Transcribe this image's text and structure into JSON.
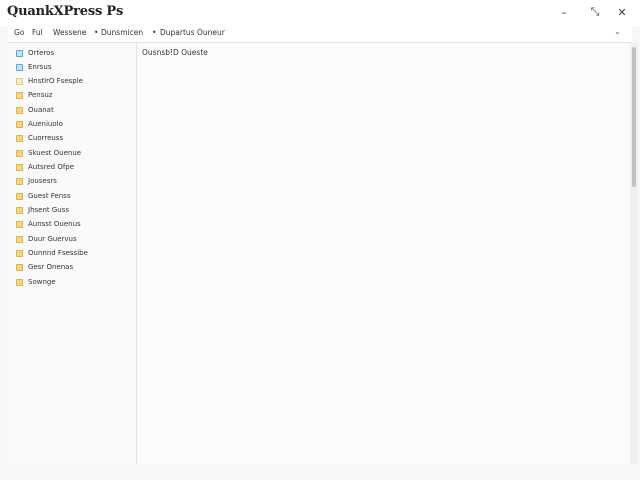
{
  "window": {
    "title": "QuankXPress Ps"
  },
  "controls": {
    "minimize": "–",
    "maximize": "⤡",
    "close": "✕"
  },
  "menubar": {
    "items": [
      "Go",
      "Ful",
      "Wessene",
      "Dunsmicen",
      "Dupartus Ouneur"
    ],
    "chevron": "⌄"
  },
  "sidebar": {
    "items": [
      {
        "label": "Orteros",
        "icon": "folder-blue-icon"
      },
      {
        "label": "Enrsus",
        "icon": "folder-blue-icon"
      },
      {
        "label": "HnstlrO Fsesple",
        "icon": "folder-pale-icon"
      },
      {
        "label": "Pensuz",
        "icon": "folder-icon"
      },
      {
        "label": "Ouanat",
        "icon": "folder-icon"
      },
      {
        "label": "Aueniuolo",
        "icon": "folder-icon"
      },
      {
        "label": "Cuorreuss",
        "icon": "folder-icon"
      },
      {
        "label": "Skuest Ouenue",
        "icon": "folder-icon"
      },
      {
        "label": "Autsred Ofpe",
        "icon": "folder-icon"
      },
      {
        "label": "Jousesrs",
        "icon": "folder-icon"
      },
      {
        "label": "Guest Fenss",
        "icon": "folder-icon"
      },
      {
        "label": "Jhsent Guss",
        "icon": "folder-icon"
      },
      {
        "label": "Aunsst Ouenus",
        "icon": "folder-icon"
      },
      {
        "label": "Duur Guervus",
        "icon": "folder-icon"
      },
      {
        "label": "Ounnnd Fsessibe",
        "icon": "folder-icon"
      },
      {
        "label": "Gesr Onenas",
        "icon": "folder-icon"
      },
      {
        "label": "Sownge",
        "icon": "folder-icon"
      }
    ]
  },
  "content": {
    "heading": "Ousnsb!D Oueste"
  }
}
